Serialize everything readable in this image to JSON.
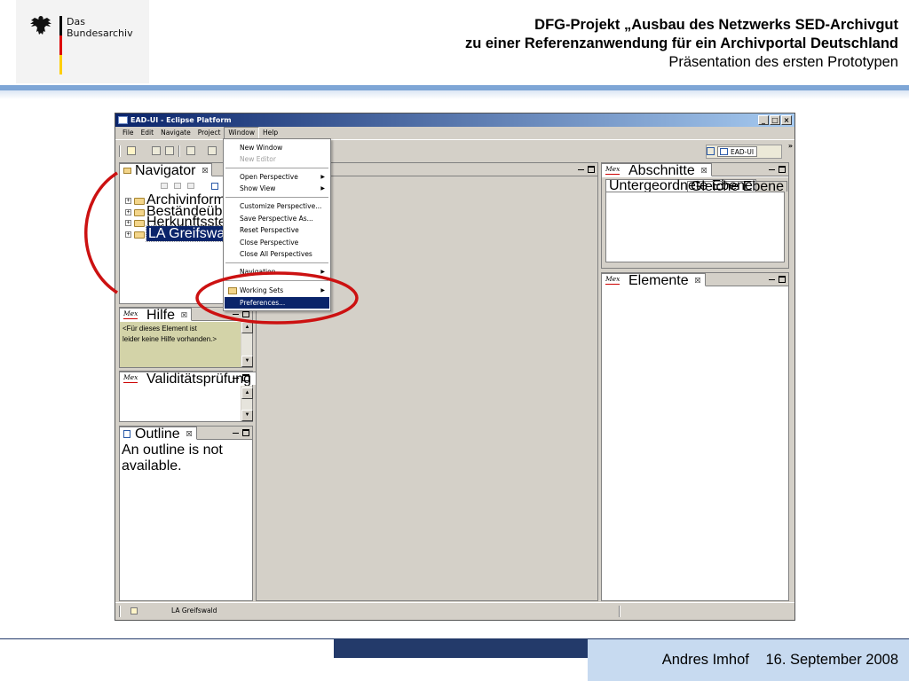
{
  "slide": {
    "logo_line1": "Das",
    "logo_line2": "Bundesarchiv",
    "title_line1": "DFG-Projekt „Ausbau des Netzwerks SED-Archivgut",
    "title_line2": "zu einer Referenzanwendung für ein Archivportal Deutschland",
    "title_line3": "Präsentation des ersten Prototypen",
    "author": "Andres Imhof",
    "date": "16. September 2008",
    "colors": {
      "header_band": "#7ea6d6",
      "footer_dark": "#233a6a",
      "footer_light": "#c7daf0",
      "highlight": "#cc1111"
    }
  },
  "window": {
    "title": "EAD-UI - Eclipse Platform",
    "menubar": [
      "File",
      "Edit",
      "Navigate",
      "Project",
      "Window",
      "Help"
    ],
    "active_menu": "Window",
    "perspective": "EAD-UI",
    "more": "»"
  },
  "window_menu": {
    "items": {
      "new_window": "New Window",
      "new_editor": "New Editor",
      "open_perspective": "Open Perspective",
      "show_view": "Show View",
      "customize_perspective": "Customize Perspective...",
      "save_perspective": "Save Perspective As...",
      "reset_perspective": "Reset Perspective",
      "close_perspective": "Close Perspective",
      "close_all_perspectives": "Close All Perspectives",
      "navigation": "Navigation",
      "working_sets": "Working Sets",
      "preferences": "Preferences..."
    },
    "arrow": "▶",
    "selected": "Preferences..."
  },
  "navigator": {
    "tab": "Navigator",
    "close": "☒",
    "items": [
      "Archivinformation",
      "Beständeübersicht",
      "Herkunftsstellen",
      "LA Greifswald"
    ],
    "selected": "LA Greifswald",
    "expander": "+"
  },
  "hilfe": {
    "mex": "Mex",
    "tab": "Hilfe",
    "close": "☒",
    "text_line1": "<Für dieses Element ist",
    "text_line2": "leider keine Hilfe vorhanden.>",
    "bg_color": "#d3d3a8"
  },
  "validity": {
    "mex": "Mex",
    "tab": "Validitätsprüfung",
    "close": "☒"
  },
  "outline": {
    "tab": "Outline",
    "close": "☒",
    "message": "An outline is not available."
  },
  "abschnitte": {
    "mex": "Mex",
    "tab": "Abschnitte",
    "close": "☒",
    "subtabs": [
      "Untergeordnete Ebene",
      "Gleiche Ebene"
    ]
  },
  "elemente": {
    "mex": "Mex",
    "tab": "Elemente",
    "close": "☒"
  },
  "statusbar": {
    "text": "LA Greifswald"
  },
  "scroll": {
    "up": "▲",
    "down": "▼"
  }
}
